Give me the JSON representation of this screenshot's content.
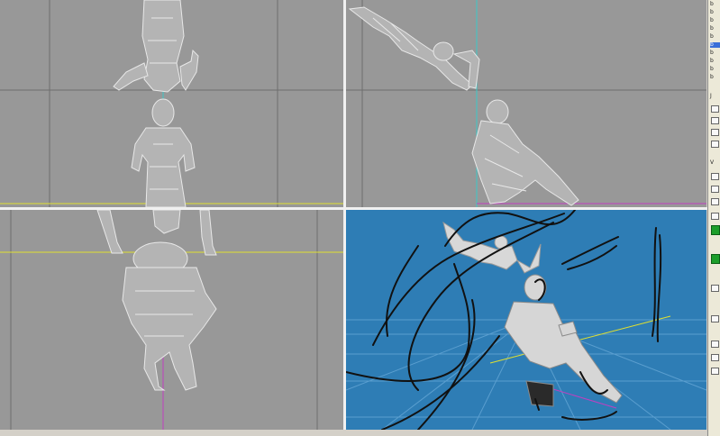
{
  "viewports": [
    {
      "id": "top-left",
      "view": "wireframe",
      "background": "#989898"
    },
    {
      "id": "top-right",
      "view": "wireframe",
      "background": "#989898"
    },
    {
      "id": "bottom-left",
      "view": "wireframe",
      "background": "#989898"
    },
    {
      "id": "bottom-right",
      "view": "shaded-with-sketch",
      "background": "#2e7db5"
    }
  ],
  "side_panel": {
    "list_items": [
      "b",
      "b",
      "b",
      "b",
      "b",
      "b",
      "b",
      "b",
      "b",
      "b"
    ],
    "selected_index": 5,
    "labels": [
      "J",
      "V"
    ]
  },
  "colors": {
    "axis_cyan": "#3cc9c9",
    "axis_magenta": "#c040c0",
    "axis_yellow": "#e0e030",
    "wire": "#e8e8e8",
    "sketch": "#111111"
  }
}
